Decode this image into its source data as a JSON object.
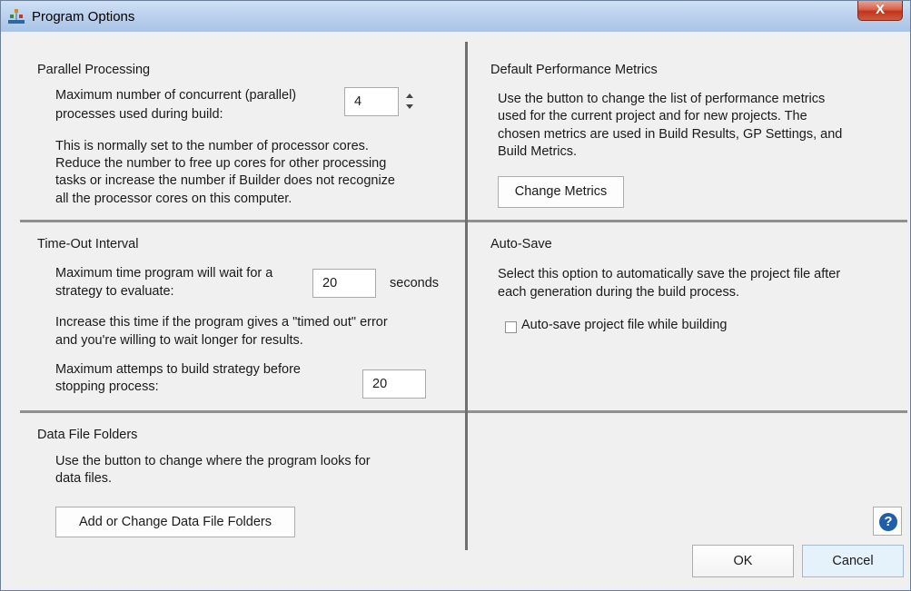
{
  "window": {
    "title": "Program Options",
    "close_label": "X"
  },
  "parallel": {
    "heading": "Parallel Processing",
    "label_line1": "Maximum number of concurrent (parallel)",
    "label_line2": "processes used during build:",
    "value": "4",
    "desc_line1": "This is normally set to the number of processor cores.",
    "desc_line2": "Reduce the number to free up cores for other processing",
    "desc_line3": "tasks or increase the number if Builder does not recognize",
    "desc_line4": "all the processor cores on this computer."
  },
  "timeout": {
    "heading": "Time-Out Interval",
    "label_line1": "Maximum time program will wait for a",
    "label_line2": "strategy to evaluate:",
    "value": "20",
    "unit": "seconds",
    "desc_line1": "Increase this time if the program gives a \"timed out\" error",
    "desc_line2": "and you're willing to wait longer for results.",
    "attempts_line1": "Maximum attemps to build strategy before",
    "attempts_line2": "stopping process:",
    "attempts_value": "20"
  },
  "datafolders": {
    "heading": "Data File Folders",
    "desc_line1": "Use the button to change where the program looks for",
    "desc_line2": "data files.",
    "button": "Add or Change Data File Folders"
  },
  "metrics": {
    "heading": "Default Performance Metrics",
    "desc_line1": "Use the button to change the list of performance metrics",
    "desc_line2": "used for the current project and for new projects. The",
    "desc_line3": "chosen metrics are used in Build Results, GP Settings, and",
    "desc_line4": "Build Metrics.",
    "button": "Change Metrics"
  },
  "autosave": {
    "heading": "Auto-Save",
    "desc_line1": "Select this option to automatically save the project file after",
    "desc_line2": "each generation during the build process.",
    "checkbox_label": "Auto-save project file while building",
    "checked": false
  },
  "footer": {
    "help_label": "?",
    "ok": "OK",
    "cancel": "Cancel"
  }
}
